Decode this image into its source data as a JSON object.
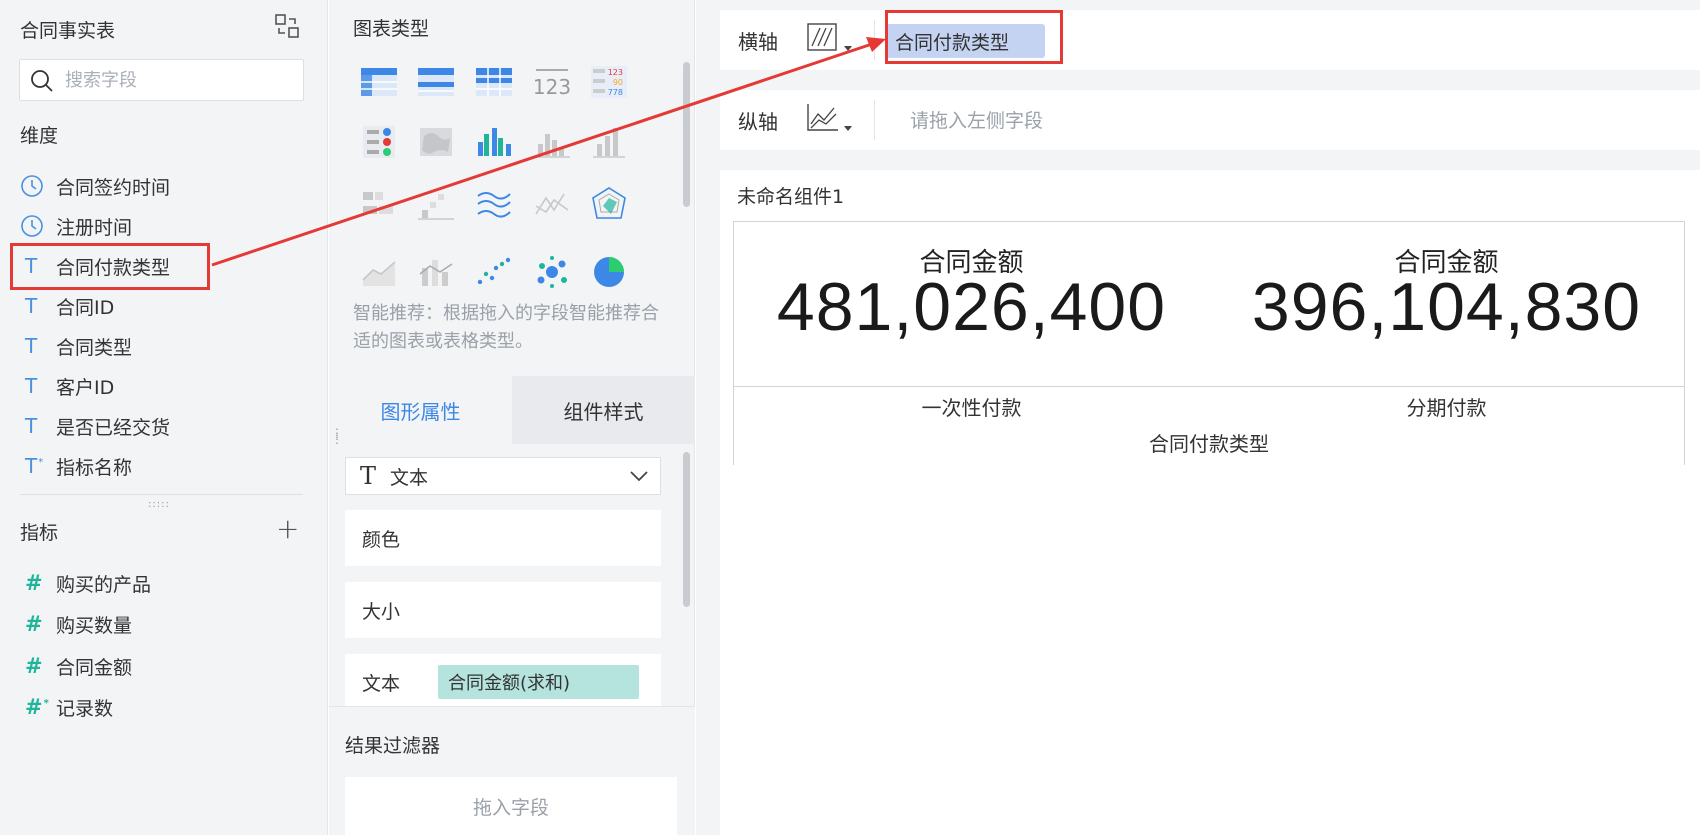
{
  "left_panel": {
    "title": "合同事实表",
    "search_placeholder": "搜索字段",
    "dimensions_title": "维度",
    "dimensions": [
      {
        "label": "合同签约时间",
        "type": "time"
      },
      {
        "label": "注册时间",
        "type": "time"
      },
      {
        "label": "合同付款类型",
        "type": "text"
      },
      {
        "label": "合同ID",
        "type": "text"
      },
      {
        "label": "合同类型",
        "type": "text"
      },
      {
        "label": "客户ID",
        "type": "text"
      },
      {
        "label": "是否已经交货",
        "type": "text"
      },
      {
        "label": "指标名称",
        "type": "text-calc"
      }
    ],
    "measures_title": "指标",
    "measures": [
      {
        "label": "购买的产品",
        "type": "number"
      },
      {
        "label": "购买数量",
        "type": "number"
      },
      {
        "label": "合同金额",
        "type": "number"
      },
      {
        "label": "记录数",
        "type": "number-calc"
      }
    ]
  },
  "middle_panel": {
    "chart_types_title": "图表类型",
    "recommend_text": "智能推荐：根据拖入的字段智能推荐合适的图表或表格类型。",
    "tabs": [
      "图形属性",
      "组件样式"
    ],
    "mark_type": "文本",
    "props": {
      "color": "颜色",
      "size": "大小",
      "text": "文本"
    },
    "text_field": "合同金额(求和)",
    "result_filter_title": "结果过滤器",
    "drop_placeholder": "拖入字段"
  },
  "axes": {
    "x_label": "横轴",
    "x_field": "合同付款类型",
    "y_label": "纵轴",
    "y_placeholder": "请拖入左侧字段"
  },
  "canvas": {
    "component_title": "未命名组件1",
    "kpis": [
      {
        "label": "合同金额",
        "value": "481,026,400",
        "category": "一次性付款"
      },
      {
        "label": "合同金额",
        "value": "396,104,830",
        "category": "分期付款"
      }
    ],
    "dimension_title": "合同付款类型"
  },
  "colors": {
    "accent": "#3d87e6",
    "highlight": "#e53935",
    "dimension_icon": "#4a90e2",
    "measure_icon": "#1fb59b"
  }
}
